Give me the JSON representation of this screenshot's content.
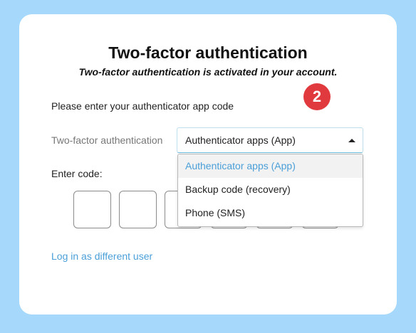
{
  "header": {
    "title": "Two-factor authentication",
    "subtitle": "Two-factor authentication is activated in your account."
  },
  "step_badge": "2",
  "instruction": "Please enter your authenticator app code",
  "method": {
    "label": "Two-factor authentication",
    "selected": "Authenticator apps (App)",
    "options": [
      "Authenticator apps (App)",
      "Backup code (recovery)",
      "Phone (SMS)"
    ]
  },
  "code": {
    "label": "Enter code:",
    "digits": [
      "",
      "",
      "",
      "",
      "",
      ""
    ]
  },
  "footer": {
    "link": "Log in as different user"
  },
  "colors": {
    "background": "#a6d8fb",
    "card": "#ffffff",
    "accent": "#4a9fd8",
    "badge": "#e03a3e"
  }
}
